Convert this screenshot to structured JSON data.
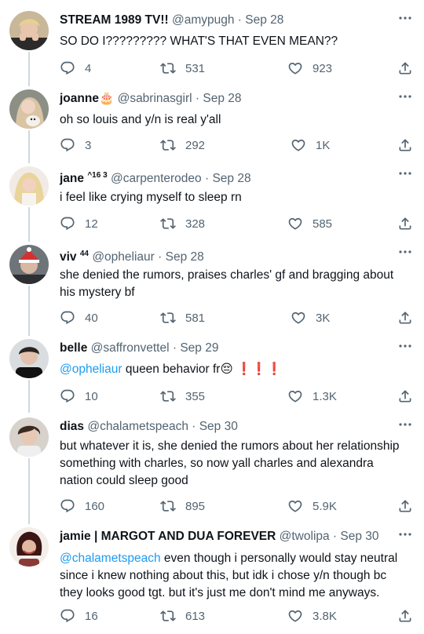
{
  "tweets": [
    {
      "name": "STREAM 1989 TV!!",
      "sup": "",
      "handle": "@amypugh",
      "date": "Sep 28",
      "text": "SO DO I????????? WHAT'S THAT EVEN MEAN??",
      "replies": "4",
      "retweets": "531",
      "likes": "923"
    },
    {
      "name": "joanne",
      "sup": "",
      "emoji": "🎂",
      "handle": "@sabrinasgirl",
      "date": "Sep 28",
      "text": "oh so louis and y/n is real y'all",
      "replies": "3",
      "retweets": "292",
      "likes": "1K"
    },
    {
      "name": "jane",
      "sup": "^16 3",
      "handle": "@carpenterodeo",
      "date": "Sep 28",
      "text": "i feel like crying myself to sleep rn",
      "replies": "12",
      "retweets": "328",
      "likes": "585"
    },
    {
      "name": "viv",
      "sup": "44",
      "handle": "@opheliaur",
      "date": "Sep 28",
      "text_line1": "she denied the rumors, praises charles' gf and bragging about",
      "text_line2": "his mystery bf",
      "replies": "40",
      "retweets": "581",
      "likes": "3K"
    },
    {
      "name": "belle",
      "sup": "",
      "handle": "@saffronvettel",
      "date": "Sep 29",
      "mention": "@opheliaur",
      "text": " queen behavior fr",
      "emoji": "😔",
      "bangs": "❗❗❗",
      "replies": "10",
      "retweets": "355",
      "likes": "1.3K"
    },
    {
      "name": "dias",
      "sup": "",
      "handle": "@chalametspeach",
      "date": "Sep 30",
      "text_line1": "but whatever it is, she denied the rumors about her relationship",
      "text_line2": "something with charles, so now yall charles and alexandra",
      "text_line3": "nation could sleep good",
      "replies": "160",
      "retweets": "895",
      "likes": "5.9K"
    },
    {
      "name": "jamie | MARGOT AND DUA FOREVER",
      "sup": "",
      "handle": "@twolipa",
      "date": "Sep 30",
      "mention": "@chalametspeach",
      "text_line1": " even though i personally would stay neutral",
      "text_line2": "since i knew nothing about this, but idk i chose y/n though bc",
      "text_line3": "they looks good tgt. but it's just me don't mind me anyways.",
      "replies": "16",
      "retweets": "613",
      "likes": "3.8K"
    }
  ],
  "icons": [
    "reply-icon",
    "retweet-icon",
    "like-icon",
    "share-icon",
    "more-icon"
  ],
  "colors": {
    "text": "#0f1419",
    "muted": "#536471",
    "link": "#1d9bf0",
    "thread": "#cfd9de"
  }
}
